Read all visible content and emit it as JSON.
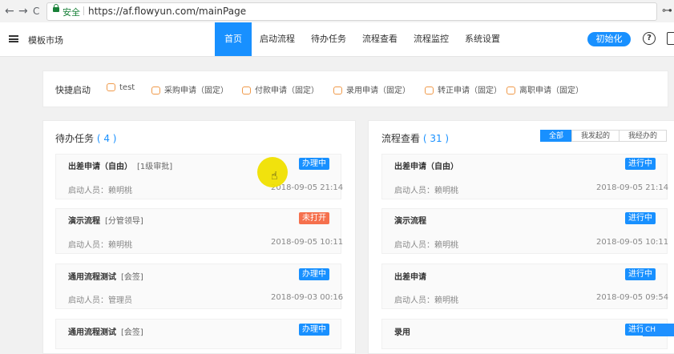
{
  "browser": {
    "secure_label": "安全",
    "url": "https://af.flowyun.com/mainPage",
    "back_glyph": "←",
    "forward_glyph": "→",
    "reload_glyph": "C",
    "key_glyph": "⊶"
  },
  "header": {
    "brand": "模板市场",
    "nav": [
      "首页",
      "启动流程",
      "待办任务",
      "流程查看",
      "流程监控",
      "系统设置"
    ],
    "active_nav": "首页",
    "init_button": "初始化",
    "help_glyph": "?"
  },
  "quick_launch": {
    "title": "快捷启动",
    "items": [
      "test",
      "采购申请（固定）",
      "付款申请（固定）",
      "录用申请（固定）",
      "转正申请（固定）",
      "离职申请（固定）"
    ]
  },
  "todo": {
    "title": "待办任务",
    "count": "( 4 )",
    "cards": [
      {
        "title": "出差申请（自由）",
        "tag": "[1级审批]",
        "badge": "办理中",
        "user": "启动人员：赖明桃",
        "date": "2018-09-05 21:14"
      },
      {
        "title": "演示流程",
        "tag": "[分管领导]",
        "badge": "未打开",
        "user": "启动人员：赖明桃",
        "date": "2018-09-05 10:11"
      },
      {
        "title": "通用流程测试",
        "tag": "[会签]",
        "badge": "办理中",
        "user": "启动人员：管理员",
        "date": "2018-09-03 00:16"
      },
      {
        "title": "通用流程测试",
        "tag": "[会签]",
        "badge": "办理中",
        "user": "",
        "date": ""
      }
    ]
  },
  "flow": {
    "title": "流程查看",
    "count": "( 31 )",
    "filters": [
      "全部",
      "我发起的",
      "我经办的"
    ],
    "active_filter": "全部",
    "cards": [
      {
        "title": "出差申请（自由）",
        "badge": "进行中",
        "user": "启动人员：赖明桃",
        "date": "2018-09-05 21:14"
      },
      {
        "title": "演示流程",
        "badge": "进行中",
        "user": "启动人员：赖明桃",
        "date": "2018-09-05 10:11"
      },
      {
        "title": "出差申请",
        "badge": "进行中",
        "user": "启动人员：赖明桃",
        "date": "2018-09-05 09:54"
      },
      {
        "title": "录用",
        "badge": "进行",
        "user": "",
        "date": ""
      }
    ]
  },
  "ime": {
    "label": "CH"
  },
  "colors": {
    "accent": "#1890ff",
    "warning": "#f5704d",
    "secure": "#188038"
  }
}
